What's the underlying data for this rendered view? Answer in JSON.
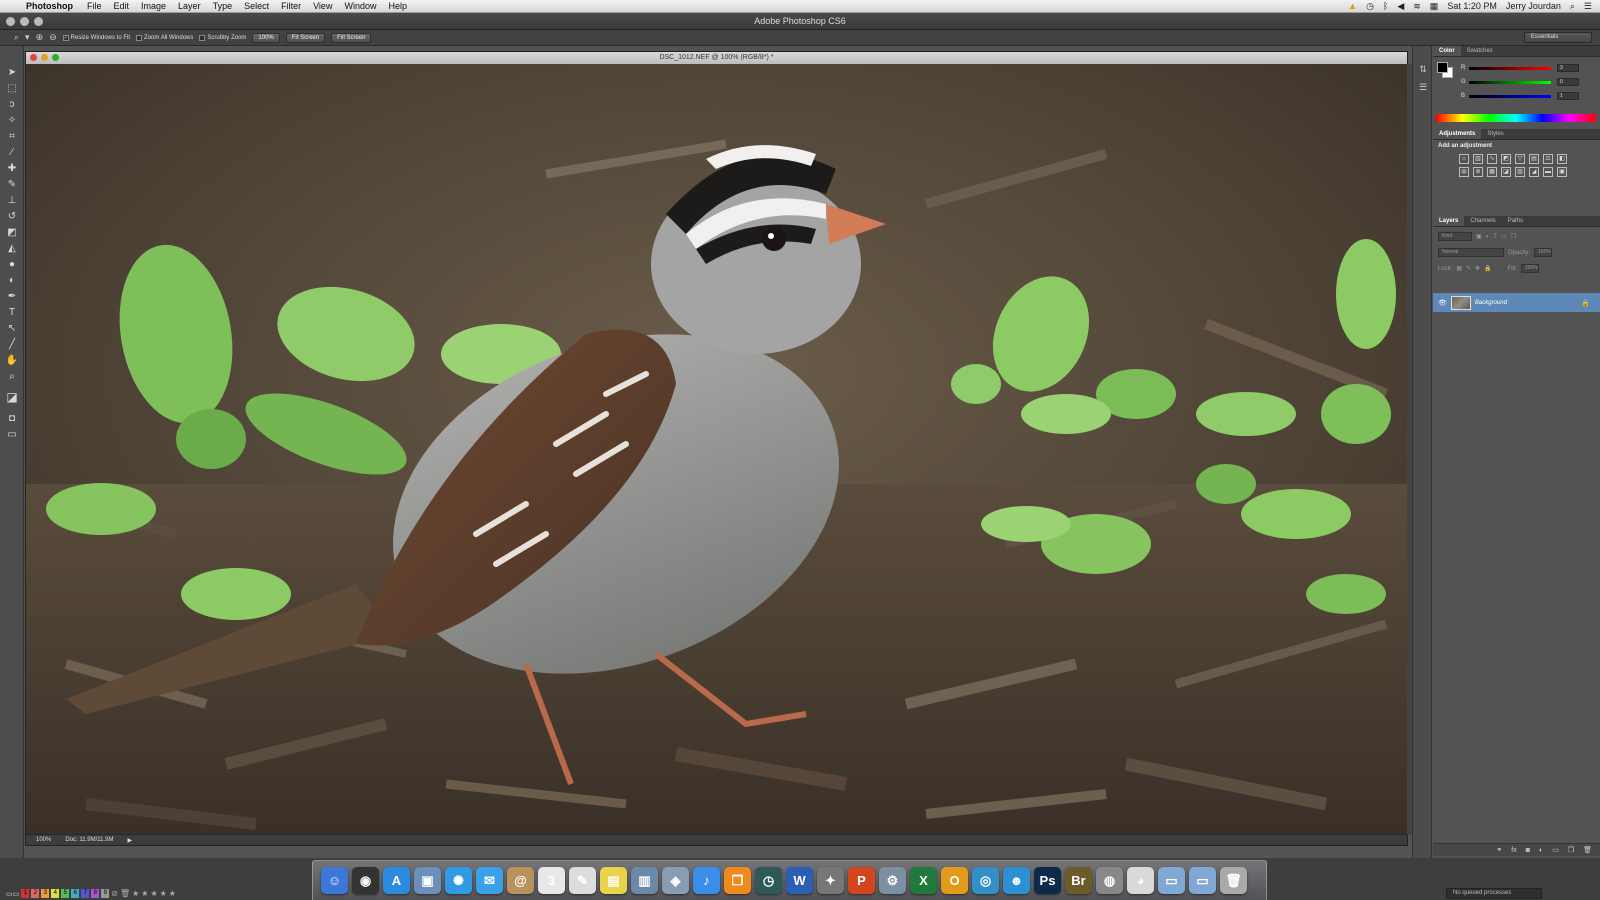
{
  "menubar": {
    "app": "Photoshop",
    "items": [
      "File",
      "Edit",
      "Image",
      "Layer",
      "Type",
      "Select",
      "Filter",
      "View",
      "Window",
      "Help"
    ],
    "clock": "Sat 1:20 PM",
    "user": "Jerry Jourdan"
  },
  "app_title": "Adobe Photoshop CS6",
  "options": {
    "resize": "Resize Windows to Fit",
    "zoom_all": "Zoom All Windows",
    "scrubby": "Scrubby Zoom",
    "zoom_value": "100%",
    "fit_screen": "Fit Screen",
    "fill_screen": "Fill Screen",
    "workspace": "Essentials"
  },
  "document": {
    "title": "DSC_1012.NEF @ 100% (RGB/8*) *",
    "zoom": "100%",
    "doc_size": "Doc: 11.9M/11.9M"
  },
  "color_panel": {
    "tabs": [
      "Color",
      "Swatches"
    ],
    "r": "3",
    "g": "0",
    "b": "1"
  },
  "adjustments_panel": {
    "tabs": [
      "Adjustments",
      "Styles"
    ],
    "label": "Add an adjustment"
  },
  "layers_panel": {
    "tabs": [
      "Layers",
      "Channels",
      "Paths"
    ],
    "kind": "Kind",
    "blend": "Normal",
    "opacity_label": "Opacity:",
    "opacity": "100%",
    "lock_label": "Lock:",
    "fill_label": "Fill:",
    "fill": "100%",
    "layer_name": "Background"
  },
  "statusbar": {
    "labels": [
      "1",
      "2",
      "3",
      "4",
      "5",
      "6",
      "7",
      "8",
      "9"
    ],
    "label_colors": [
      "#c33",
      "#d66",
      "#e94",
      "#dd4",
      "#5b5",
      "#4ac",
      "#55c",
      "#a5c",
      "#999"
    ],
    "queue": "No queued processes"
  },
  "dock": {
    "items": [
      {
        "name": "finder",
        "glyph": "☺",
        "color": "#3b78d8"
      },
      {
        "name": "dashboard",
        "glyph": "◉",
        "color": "#333"
      },
      {
        "name": "app-store",
        "glyph": "A",
        "color": "#2a8be0"
      },
      {
        "name": "preview",
        "glyph": "▣",
        "color": "#6a8fb8"
      },
      {
        "name": "safari",
        "glyph": "✺",
        "color": "#2f9be6"
      },
      {
        "name": "messages",
        "glyph": "✉",
        "color": "#3aa0e8"
      },
      {
        "name": "contacts",
        "glyph": "@",
        "color": "#b8925a"
      },
      {
        "name": "calendar",
        "glyph": "3",
        "color": "#e8e8e8"
      },
      {
        "name": "textedit",
        "glyph": "✎",
        "color": "#ddd"
      },
      {
        "name": "stickies",
        "glyph": "▤",
        "color": "#e8d34a"
      },
      {
        "name": "photo-browser",
        "glyph": "▥",
        "color": "#6b8aa9"
      },
      {
        "name": "image-capture",
        "glyph": "◈",
        "color": "#8a9cb2"
      },
      {
        "name": "itunes",
        "glyph": "♪",
        "color": "#3b8ee8"
      },
      {
        "name": "ibooks",
        "glyph": "❐",
        "color": "#ef8a1c"
      },
      {
        "name": "time-machine",
        "glyph": "◷",
        "color": "#2d5a55"
      },
      {
        "name": "word",
        "glyph": "W",
        "color": "#2b5fb4"
      },
      {
        "name": "utility",
        "glyph": "✦",
        "color": "#777"
      },
      {
        "name": "powerpoint",
        "glyph": "P",
        "color": "#d4451f"
      },
      {
        "name": "automator",
        "glyph": "⚙",
        "color": "#7d8fa2"
      },
      {
        "name": "excel",
        "glyph": "X",
        "color": "#1f7a3c"
      },
      {
        "name": "outlook",
        "glyph": "O",
        "color": "#e09b18"
      },
      {
        "name": "network",
        "glyph": "◎",
        "color": "#3290c8"
      },
      {
        "name": "messenger",
        "glyph": "☻",
        "color": "#2d8fd4"
      },
      {
        "name": "photoshop",
        "glyph": "Ps",
        "color": "#0d2a4a"
      },
      {
        "name": "bridge",
        "glyph": "Br",
        "color": "#6b5a2a"
      },
      {
        "name": "disk-utility",
        "glyph": "◍",
        "color": "#888"
      },
      {
        "name": "chrome",
        "glyph": "◕",
        "color": "#d9d9d9"
      },
      {
        "name": "apps-folder",
        "glyph": "▭",
        "color": "#7fa8d4"
      },
      {
        "name": "documents-folder",
        "glyph": "▭",
        "color": "#7fa8d4"
      },
      {
        "name": "trash",
        "glyph": "🗑",
        "color": "#aaa"
      }
    ]
  }
}
